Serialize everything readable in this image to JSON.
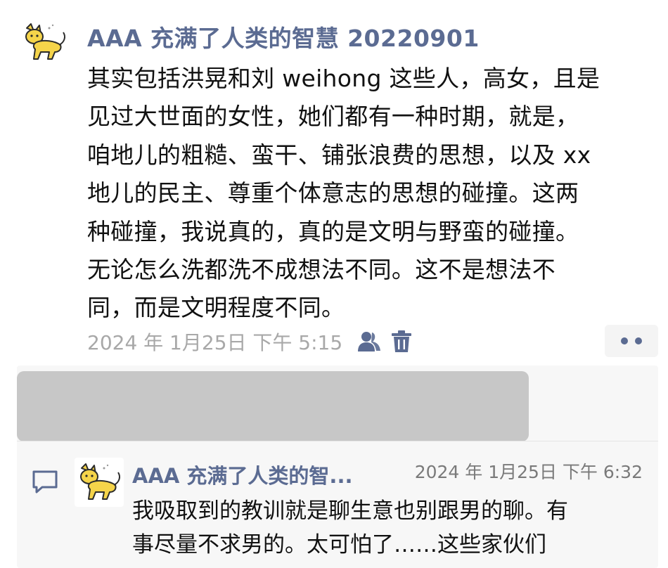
{
  "post": {
    "author": "AAA 充满了人类的智慧 20220901",
    "avatar": "cat-avatar-icon",
    "text": "其实包括洪晃和刘 weihong 这些人，高女，且是\n见过大世面的女性，她们都有一种时期，就是，\n咱地儿的粗糙、蛮干、铺张浪费的思想，以及 xx\n地儿的民主、尊重个体意志的思想的碰撞。这两\n种碰撞，我说真的，真的是文明与野蛮的碰撞。\n无论怎么洗都洗不成想法不同。这不是想法不\n同，而是文明程度不同。",
    "time": "2024 年 1月25日 下午 5:15",
    "icons": {
      "visibility": "contacts-icon",
      "delete": "trash-icon",
      "more": "more-dots-icon"
    }
  },
  "comment": {
    "icon": "comment-bubble-icon",
    "avatar": "cat-avatar-icon",
    "author": "AAA 充满了人类的智...",
    "time": "2024 年 1月25日 下午 6:32",
    "text": "我吸取到的教训就是聊生意也别跟男的聊。有\n事尽量不求男的。太可怕了……这些家伙们"
  },
  "colors": {
    "name": "#5b6b92",
    "body_text": "#111111",
    "meta_text": "#a8a8a8",
    "comment_background": "#f7f7f7",
    "redacted_block": "#c7c7c7",
    "avatar_cat": "#f5d44a"
  }
}
